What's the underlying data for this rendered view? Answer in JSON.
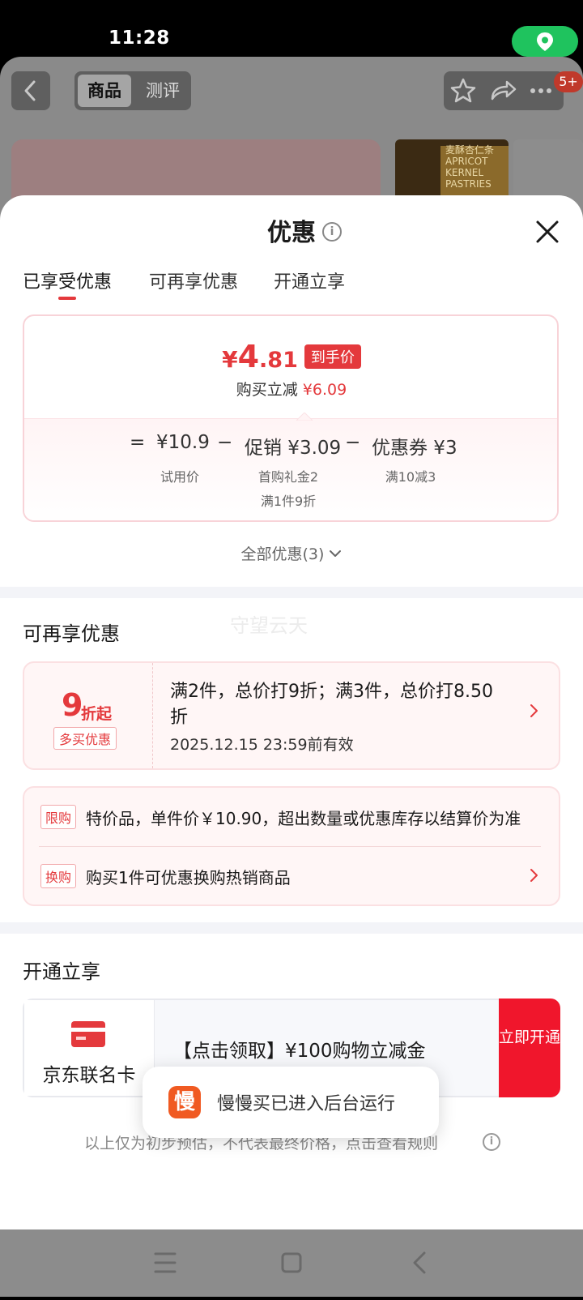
{
  "status_bar": {
    "time": "11:28"
  },
  "underlying_page": {
    "tabs": [
      "商品",
      "测评"
    ],
    "notification_badge": "5+",
    "product_image_text": "麦酥杏仁条\nAPRICOT\nKERNEL PASTRIES"
  },
  "sheet": {
    "title": "优惠",
    "tabs": [
      "已享受优惠",
      "可再享优惠",
      "开通立享"
    ],
    "price_summary": {
      "currency": "¥",
      "price_int": "4",
      "price_dec": ".81",
      "price_tag": "到手价",
      "save_label": "购买立减",
      "save_amount": "¥6.09"
    },
    "calculation": {
      "equals": "=",
      "minus": "−",
      "items": [
        {
          "value": "¥10.9",
          "desc": "试用价"
        },
        {
          "value": "促销 ¥3.09",
          "desc": "首购礼金2",
          "desc2": "满1件9折"
        },
        {
          "value": "优惠券 ¥3",
          "desc": "满10减3"
        }
      ]
    },
    "all_discounts": "全部优惠(3)",
    "section_more": {
      "title": "可再享优惠",
      "watermark": "守望云天",
      "multi_buy": {
        "big": "9",
        "unit": "折起",
        "badge": "多买优惠",
        "text": "满2件，总价打9折；满3件，总价打8.50折",
        "valid": "2025.12.15 23:59前有效"
      },
      "rules": [
        {
          "badge": "限购",
          "text": "特价品，单件价￥10.90，超出数量或优惠库存以结算价为准"
        },
        {
          "badge": "换购",
          "text": "购买1件可优惠换购热销商品"
        }
      ]
    },
    "section_open": {
      "title": "开通立享",
      "card_name": "京东联名卡",
      "offer": "【点击领取】¥100购物立减金",
      "button": "立即开通"
    },
    "footnote": "以上仅为初步预估，不代表最终价格，点击查看规则"
  },
  "toast": {
    "icon_char": "慢",
    "text": "慢慢买已进入后台运行"
  },
  "colors": {
    "accent": "#e4393c",
    "button_red": "#f0162c",
    "location_green": "#1fc35e",
    "toast_icon": "#f05a22"
  }
}
